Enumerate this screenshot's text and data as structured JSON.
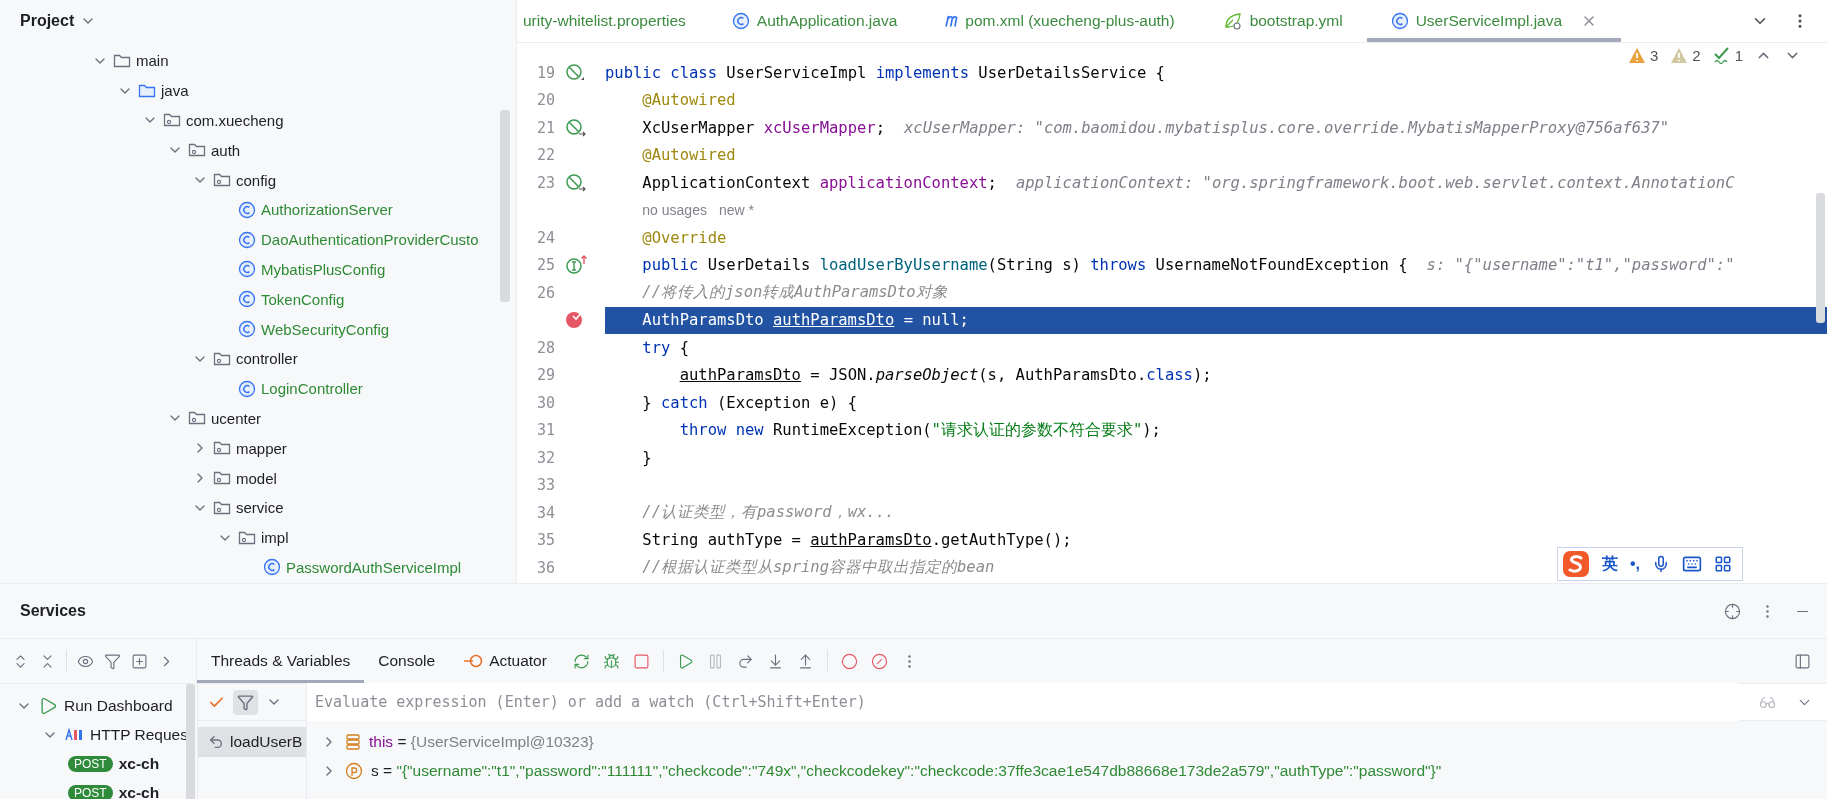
{
  "project_panel": {
    "title": "Project",
    "tree": [
      {
        "label": "main",
        "kind": "folder",
        "expanded": true,
        "children": [
          {
            "label": "java",
            "kind": "source",
            "expanded": true,
            "children": [
              {
                "label": "com.xuecheng",
                "kind": "package",
                "expanded": true,
                "children": [
                  {
                    "label": "auth",
                    "kind": "package",
                    "expanded": true,
                    "children": [
                      {
                        "label": "config",
                        "kind": "package",
                        "expanded": true,
                        "children": [
                          {
                            "label": "AuthorizationServer",
                            "kind": "class"
                          },
                          {
                            "label": "DaoAuthenticationProviderCusto",
                            "kind": "class"
                          },
                          {
                            "label": "MybatisPlusConfig",
                            "kind": "class"
                          },
                          {
                            "label": "TokenConfig",
                            "kind": "class"
                          },
                          {
                            "label": "WebSecurityConfig",
                            "kind": "class"
                          }
                        ]
                      },
                      {
                        "label": "controller",
                        "kind": "package",
                        "expanded": true,
                        "children": [
                          {
                            "label": "LoginController",
                            "kind": "class"
                          }
                        ]
                      }
                    ]
                  },
                  {
                    "label": "ucenter",
                    "kind": "package",
                    "expanded": true,
                    "children": [
                      {
                        "label": "mapper",
                        "kind": "package",
                        "expanded": false
                      },
                      {
                        "label": "model",
                        "kind": "package",
                        "expanded": false
                      },
                      {
                        "label": "service",
                        "kind": "package",
                        "expanded": true,
                        "children": [
                          {
                            "label": "impl",
                            "kind": "package",
                            "expanded": true,
                            "children": [
                              {
                                "label": "PasswordAuthServiceImpl",
                                "kind": "class"
                              }
                            ]
                          }
                        ]
                      }
                    ]
                  }
                ]
              }
            ]
          }
        ]
      }
    ]
  },
  "editor_tabs": [
    {
      "label": "urity-whitelist.properties",
      "kind": "properties",
      "selected": false
    },
    {
      "label": "AuthApplication.java",
      "kind": "class",
      "selected": false
    },
    {
      "label": "pom.xml (xuecheng-plus-auth)",
      "kind": "maven",
      "selected": false
    },
    {
      "label": "bootstrap.yml",
      "kind": "yaml",
      "selected": false
    },
    {
      "label": "UserServiceImpl.java",
      "kind": "class",
      "selected": true
    }
  ],
  "inspections": {
    "errors": "3",
    "warnings": "2",
    "typos": "1"
  },
  "editor": {
    "lines": [
      {
        "kind": "code",
        "number": "19",
        "gutter": {
          "kind": "bean"
        },
        "selected": false,
        "tokens": [
          {
            "kind": "kw",
            "text": "public class "
          },
          {
            "kind": "plain",
            "text": "UserServiceImpl "
          },
          {
            "kind": "kw",
            "text": "implements "
          },
          {
            "kind": "plain",
            "text": "UserDetailsService {"
          }
        ],
        "children": [
          {
            "kind": "code",
            "number": "20",
            "selected": false,
            "tokens": [
              {
                "kind": "ann",
                "text": "@Autowired"
              }
            ]
          },
          {
            "kind": "code",
            "number": "21",
            "gutter": {
              "kind": "bean-link"
            },
            "selected": false,
            "tokens": [
              {
                "kind": "plain",
                "text": "XcUserMapper "
              },
              {
                "kind": "field",
                "text": "xcUserMapper"
              },
              {
                "kind": "plain",
                "text": ";"
              }
            ],
            "hint": "xcUserMapper: \"com.baomidou.mybatisplus.core.override.MybatisMapperProxy@756af637\""
          },
          {
            "kind": "code",
            "number": "22",
            "selected": false,
            "tokens": [
              {
                "kind": "ann",
                "text": "@Autowired"
              }
            ]
          },
          {
            "kind": "code",
            "number": "23",
            "gutter": {
              "kind": "bean-link"
            },
            "selected": false,
            "tokens": [
              {
                "kind": "plain",
                "text": "ApplicationContext "
              },
              {
                "kind": "field",
                "text": "applicationContext"
              },
              {
                "kind": "plain",
                "text": ";"
              }
            ],
            "hint": "applicationContext: \"org.springframework.boot.web.servlet.context.AnnotationC"
          },
          {
            "kind": "usage",
            "texts": [
              "no usages",
              "new *"
            ]
          },
          {
            "kind": "code",
            "number": "24",
            "selected": false,
            "tokens": [
              {
                "kind": "ann",
                "text": "@Override"
              }
            ]
          },
          {
            "kind": "code",
            "number": "25",
            "gutter": {
              "kind": "implements"
            },
            "selected": false,
            "tokens": [
              {
                "kind": "kw",
                "text": "public "
              },
              {
                "kind": "plain",
                "text": "UserDetails "
              },
              {
                "kind": "method",
                "text": "loadUserByUsername"
              },
              {
                "kind": "plain",
                "text": "(String s) "
              },
              {
                "kind": "kw",
                "text": "throws "
              },
              {
                "kind": "plain",
                "text": "UsernameNotFoundException {"
              }
            ],
            "hint": "s: \"{\"username\":\"t1\",\"password\":\""
          },
          {
            "kind": "code",
            "number": "26",
            "selected": false,
            "tokens": [
              {
                "kind": "comment",
                "text": "//将传入的json转成AuthParamsDto对象"
              }
            ]
          },
          {
            "kind": "code",
            "gutter": {
              "kind": "breakpoint"
            },
            "selected": true,
            "tokens": [
              {
                "kind": "plain",
                "text": "AuthParamsDto "
              },
              {
                "kind": "var",
                "text": "authParamsDto"
              },
              {
                "kind": "plain",
                "text": " = null;"
              }
            ]
          },
          {
            "kind": "code",
            "number": "28",
            "selected": false,
            "tokens": [
              {
                "kind": "kw",
                "text": "try "
              },
              {
                "kind": "plain",
                "text": "{"
              }
            ],
            "children": [
              {
                "kind": "code",
                "number": "29",
                "selected": false,
                "tokens": [
                  {
                    "kind": "var",
                    "text": "authParamsDto"
                  },
                  {
                    "kind": "plain",
                    "text": " = JSON."
                  },
                  {
                    "kind": "static",
                    "text": "parseObject"
                  },
                  {
                    "kind": "plain",
                    "text": "(s, AuthParamsDto."
                  },
                  {
                    "kind": "kw",
                    "text": "class"
                  },
                  {
                    "kind": "plain",
                    "text": ");"
                  }
                ]
              }
            ]
          },
          {
            "kind": "code",
            "number": "30",
            "selected": false,
            "tokens": [
              {
                "kind": "plain",
                "text": "} "
              },
              {
                "kind": "kw",
                "text": "catch "
              },
              {
                "kind": "plain",
                "text": "(Exception e) {"
              }
            ],
            "children": [
              {
                "kind": "code",
                "number": "31",
                "selected": false,
                "tokens": [
                  {
                    "kind": "kw",
                    "text": "throw new "
                  },
                  {
                    "kind": "plain",
                    "text": "RuntimeException("
                  },
                  {
                    "kind": "string",
                    "text": "\"请求认证的参数不符合要求\""
                  },
                  {
                    "kind": "plain",
                    "text": ");"
                  }
                ]
              }
            ]
          },
          {
            "kind": "code",
            "number": "32",
            "selected": false,
            "tokens": [
              {
                "kind": "plain",
                "text": "}"
              }
            ]
          },
          {
            "kind": "code",
            "number": "33",
            "selected": false
          },
          {
            "kind": "code",
            "number": "34",
            "selected": false,
            "tokens": [
              {
                "kind": "comment",
                "text": "//认证类型，有password，wx..."
              }
            ]
          },
          {
            "kind": "code",
            "number": "35",
            "selected": false,
            "tokens": [
              {
                "kind": "plain",
                "text": "String authType = "
              },
              {
                "kind": "var",
                "text": "authParamsDto"
              },
              {
                "kind": "plain",
                "text": ".getAuthType();"
              }
            ]
          },
          {
            "kind": "code",
            "number": "36",
            "selected": false,
            "tokens": [
              {
                "kind": "comment",
                "text": "//根据认证类型从spring容器中取出指定的bean"
              }
            ]
          }
        ]
      }
    ]
  },
  "ime_toolbar": {
    "mode": "英",
    "punctuation": "•,"
  },
  "services": {
    "title": "Services",
    "tabs": [
      {
        "label": "Threads & Variables",
        "kind": "plain",
        "selected": true
      },
      {
        "label": "Console",
        "kind": "plain",
        "selected": false
      },
      {
        "label": "Actuator",
        "kind": "actuator",
        "selected": false
      }
    ],
    "tree": [
      {
        "label": "Run Dashboard",
        "kind": "run",
        "expanded": true,
        "children": [
          {
            "label": "HTTP Reques",
            "kind": "api",
            "expanded": true,
            "children": [
              {
                "label": "xc-ch",
                "kind": "request",
                "badge": "POST"
              },
              {
                "label": "xc-ch",
                "kind": "request",
                "badge": "POST"
              }
            ]
          }
        ]
      }
    ],
    "frames_filter": {
      "on": true
    },
    "frames": [
      {
        "label": "loadUserB",
        "selected": true
      }
    ],
    "expression": {
      "placeholder": "Evaluate expression (Enter) or add a watch (Ctrl+Shift+Enter)"
    },
    "variables": [
      {
        "kind": "object",
        "name": "this",
        "operator": "=",
        "value": "{UserServiceImpl@10323}"
      },
      {
        "kind": "param",
        "name": "s",
        "operator": "=",
        "value": "\"{\"username\":\"t1\",\"password\":\"111111\",\"checkcode\":\"749x\",\"checkcodekey\":\"checkcode:37ffe3cae1e547db88668e173de2a579\",\"authType\":\"password\"}\""
      }
    ]
  }
}
